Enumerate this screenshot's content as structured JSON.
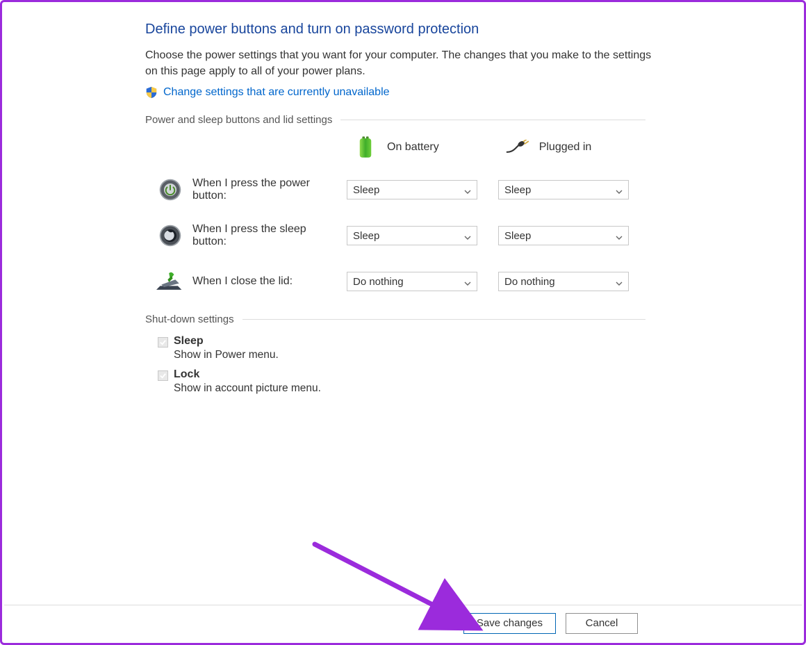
{
  "header": {
    "title": "Define power buttons and turn on password protection",
    "description": "Choose the power settings that you want for your computer. The changes that you make to the settings on this page apply to all of your power plans.",
    "admin_link": "Change settings that are currently unavailable"
  },
  "power_section": {
    "label": "Power and sleep buttons and lid settings",
    "columns": {
      "battery": "On battery",
      "plugged": "Plugged in"
    },
    "rows": [
      {
        "label": "When I press the power button:",
        "battery_value": "Sleep",
        "plugged_value": "Sleep"
      },
      {
        "label": "When I press the sleep button:",
        "battery_value": "Sleep",
        "plugged_value": "Sleep"
      },
      {
        "label": "When I close the lid:",
        "battery_value": "Do nothing",
        "plugged_value": "Do nothing"
      }
    ]
  },
  "shutdown_section": {
    "label": "Shut-down settings",
    "items": [
      {
        "title": "Sleep",
        "desc": "Show in Power menu."
      },
      {
        "title": "Lock",
        "desc": "Show in account picture menu."
      }
    ]
  },
  "footer": {
    "save": "Save changes",
    "cancel": "Cancel"
  }
}
